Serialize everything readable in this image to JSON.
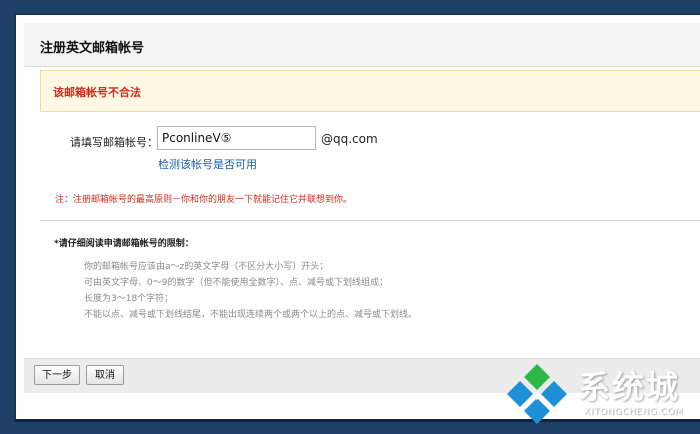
{
  "header": {
    "title": "注册英文邮箱帐号"
  },
  "alert": {
    "message": "该邮箱帐号不合法"
  },
  "form": {
    "label": "请填写邮箱帐号：",
    "email_value": "PconlineV⑤",
    "domain": "@qq.com",
    "check_link": "检测该帐号是否可用"
  },
  "note": "注：注册邮箱帐号的最高原则－你和你的朋友一下就能记住它并联想到你。",
  "rules": {
    "title": "*请仔细阅读申请邮箱帐号的限制：",
    "items": [
      "你的邮箱帐号应该由a～z的英文字母（不区分大小写）开头；",
      "可由英文字母、0～9的数字（但不能使用全数字）、点、减号或下划线组成；",
      "长度为3～18个字符；",
      "不能以点、减号或下划线结尾，不能出现连续两个或两个以上的点、减号或下划线。"
    ]
  },
  "buttons": {
    "next": "下一步",
    "cancel": "取消"
  },
  "watermark": {
    "name": "系统城",
    "url": "XITONGCHENG.COM"
  },
  "colors": {
    "error_red": "#d02b1d",
    "link_blue": "#1a5fa8",
    "logo_blue": "#1e90d8",
    "logo_green": "#2eb84a"
  }
}
